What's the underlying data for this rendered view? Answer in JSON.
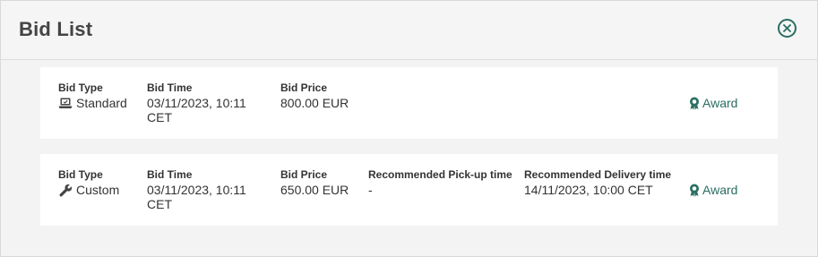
{
  "dialog": {
    "title": "Bid List",
    "close_icon": "close-circle-icon"
  },
  "colors": {
    "accent": "#2b6e62",
    "card_bg": "#ffffff",
    "modal_bg": "#f3f3f3"
  },
  "bids": [
    {
      "type_label": "Bid Type",
      "type_value": "Standard",
      "type_icon": "laptop-icon",
      "time_label": "Bid Time",
      "time_value": "03/11/2023, 10:11 CET",
      "price_label": "Bid Price",
      "price_value": "800.00 EUR",
      "action_label": "Award",
      "action_icon": "award-ribbon-icon"
    },
    {
      "type_label": "Bid Type",
      "type_value": "Custom",
      "type_icon": "wrench-icon",
      "time_label": "Bid Time",
      "time_value": "03/11/2023, 10:11 CET",
      "price_label": "Bid Price",
      "price_value": "650.00 EUR",
      "pickup_label": "Recommended Pick-up time",
      "pickup_value": "-",
      "delivery_label": "Recommended Delivery time",
      "delivery_value": "14/11/2023, 10:00 CET",
      "action_label": "Award",
      "action_icon": "award-ribbon-icon"
    }
  ]
}
